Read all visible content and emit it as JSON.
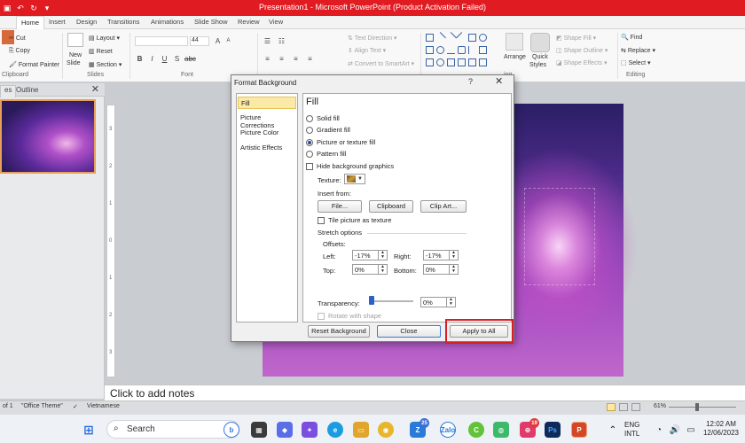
{
  "window": {
    "title": "Presentation1 - Microsoft PowerPoint (Product Activation Failed)"
  },
  "tabs": [
    "Home",
    "Insert",
    "Design",
    "Transitions",
    "Animations",
    "Slide Show",
    "Review",
    "View"
  ],
  "active_tab": "Home",
  "ribbon": {
    "clipboard": {
      "cut": "Cut",
      "copy": "Copy",
      "format_painter": "Format Painter",
      "group": "Clipboard"
    },
    "slides": {
      "new_slide": "New",
      "new_slide2": "Slide",
      "layout": "Layout",
      "reset": "Reset",
      "section": "Section",
      "group": "Slides"
    },
    "font": {
      "size": "44",
      "group": "Font"
    },
    "paragraph": {
      "text_direction": "Text Direction",
      "align_text": "Align Text",
      "convert_smartart": "Convert to SmartArt"
    },
    "drawing": {
      "arrange": "Arrange",
      "quick_styles": "Quick",
      "quick_styles2": "Styles",
      "shape_fill": "Shape Fill",
      "shape_outline": "Shape Outline",
      "shape_effects": "Shape Effects",
      "group_fragment": "ing"
    },
    "editing": {
      "find": "Find",
      "replace": "Replace",
      "select": "Select",
      "group": "Editing"
    }
  },
  "left_pane": {
    "tab_slides": "es",
    "tab_outline": "Outline",
    "close": "✕"
  },
  "vruler_numbers": [
    "3",
    "2",
    "1",
    "0",
    "1",
    "2",
    "3"
  ],
  "notes_placeholder": "Click to add notes",
  "status_bar": {
    "slide_of": "of 1",
    "theme": "\"Office Theme\"",
    "language": "Vietnamese",
    "zoom": "61%"
  },
  "taskbar": {
    "search_label": "Search",
    "badge_zalo": "25",
    "badge_app": "19",
    "lang_top": "ENG",
    "lang_bottom": "INTL",
    "time": "12:02 AM",
    "date": "12/06/2023"
  },
  "dialog": {
    "title": "Format Background",
    "help": "?",
    "close": "✕",
    "nav": [
      "Fill",
      "Picture Corrections",
      "Picture Color",
      "Artistic Effects"
    ],
    "selected_nav": "Fill",
    "heading": "Fill",
    "fill_options": [
      "Solid fill",
      "Gradient fill",
      "Picture or texture fill",
      "Pattern fill"
    ],
    "selected_fill": "Picture or texture fill",
    "hide_bg": "Hide background graphics",
    "texture_label": "Texture:",
    "insert_from": "Insert from:",
    "btn_file": "File...",
    "btn_clipboard": "Clipboard",
    "btn_clipart": "Clip Art...",
    "tile": "Tile picture as texture",
    "stretch_options": "Stretch options",
    "offsets": "Offsets:",
    "left_label": "Left:",
    "left_value": "-17%",
    "right_label": "Right:",
    "right_value": "-17%",
    "top_label": "Top:",
    "top_value": "0%",
    "bottom_label": "Bottom:",
    "bottom_value": "0%",
    "transparency_label": "Transparency:",
    "transparency_value": "0%",
    "rotate": "Rotate with shape",
    "btn_reset": "Reset Background",
    "btn_close": "Close",
    "btn_apply_all": "Apply to All"
  },
  "colors": {
    "title_bar": "#e11b22",
    "highlight": "#d61f26",
    "selected_nav": "#fbe9a8"
  }
}
